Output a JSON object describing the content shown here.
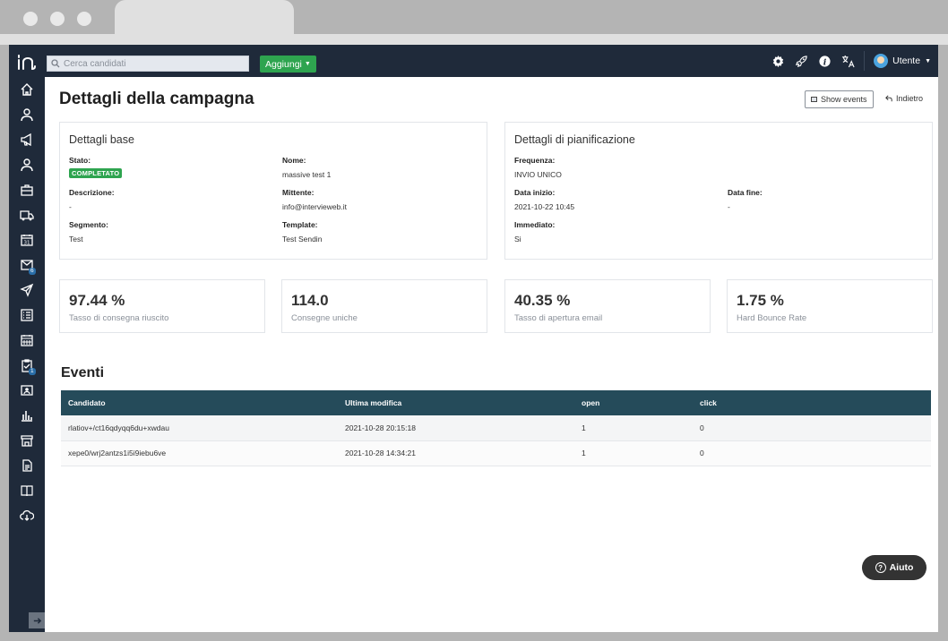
{
  "topbar": {
    "search_placeholder": "Cerca candidati",
    "add_label": "Aggiungi",
    "user_label": "Utente"
  },
  "sidebar": {
    "badges": {
      "email": "6",
      "tasks": "1"
    }
  },
  "page": {
    "title": "Dettagli della campagna",
    "show_events_label": "Show events",
    "back_label": "Indietro"
  },
  "base_details": {
    "title": "Dettagli base",
    "status_label": "Stato:",
    "status_value": "COMPLETATO",
    "name_label": "Nome:",
    "name_value": "massive test 1",
    "description_label": "Descrizione:",
    "description_value": "-",
    "sender_label": "Mittente:",
    "sender_value": "info@intervieweb.it",
    "segment_label": "Segmento:",
    "segment_value": "Test",
    "template_label": "Template:",
    "template_value": "Test Sendin"
  },
  "planning_details": {
    "title": "Dettagli di pianificazione",
    "frequency_label": "Frequenza:",
    "frequency_value": "INVIO UNICO",
    "start_label": "Data inizio:",
    "start_value": "2021-10-22 10:45",
    "end_label": "Data fine:",
    "end_value": "-",
    "immediate_label": "Immediato:",
    "immediate_value": "Si"
  },
  "stats": [
    {
      "value": "97.44 %",
      "label": "Tasso di consegna riuscito"
    },
    {
      "value": "114.0",
      "label": "Consegne uniche"
    },
    {
      "value": "40.35 %",
      "label": "Tasso di apertura email"
    },
    {
      "value": "1.75 %",
      "label": "Hard Bounce Rate"
    }
  ],
  "events": {
    "title": "Eventi",
    "columns": [
      "Candidato",
      "Ultima modifica",
      "open",
      "click"
    ],
    "rows": [
      [
        "rlatiov+/ct16qdyqq6du+xwdau",
        "2021-10-28 20:15:18",
        "1",
        "0"
      ],
      [
        "xepe0/wrj2antzs1i5i9iebu6ve",
        "2021-10-28 14:34:21",
        "1",
        "0"
      ]
    ]
  },
  "help": {
    "label": "Aiuto"
  },
  "colors": {
    "nav_bg": "#1f2a3a",
    "accent_green": "#2ea44f",
    "table_header": "#254b5a"
  }
}
